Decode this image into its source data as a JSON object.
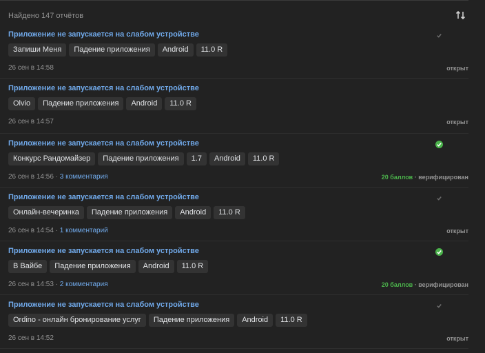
{
  "header": {
    "found_text": "Найдено 147 отчётов",
    "sort_icon": "sort-arrows-icon"
  },
  "colors": {
    "background": "#222222",
    "link": "#71aaeb",
    "tag_bg": "#333333",
    "muted": "#939393",
    "success": "#4bb34b"
  },
  "reports": [
    {
      "title": "Приложение не запускается на слабом устройстве",
      "check": "grey",
      "tags": [
        "Запиши Меня",
        "Падение приложения",
        "Android",
        "11.0 R"
      ],
      "date": "26 сен в 14:58",
      "comments": "",
      "points": "",
      "status": "открыт"
    },
    {
      "title": "Приложение не запускается на слабом устройстве",
      "check": "none",
      "tags": [
        "Olvio",
        "Падение приложения",
        "Android",
        "11.0 R"
      ],
      "date": "26 сен в 14:57",
      "comments": "",
      "points": "",
      "status": "открыт"
    },
    {
      "title": "Приложение не запускается на слабом устройстве",
      "check": "green",
      "tags": [
        "Конкурс Рандомайзер",
        "Падение приложения",
        "1.7",
        "Android",
        "11.0 R"
      ],
      "date": "26 сен в 14:56",
      "comments": "3 комментария",
      "points": "20 баллов",
      "status": "верифицирован"
    },
    {
      "title": "Приложение не запускается на слабом устройстве",
      "check": "grey",
      "tags": [
        "Онлайн-вечеринка",
        "Падение приложения",
        "Android",
        "11.0 R"
      ],
      "date": "26 сен в 14:54",
      "comments": "1 комментарий",
      "points": "",
      "status": "открыт"
    },
    {
      "title": "Приложение не запускается на слабом устройстве",
      "check": "green",
      "tags": [
        "В Вайбе",
        "Падение приложения",
        "Android",
        "11.0 R"
      ],
      "date": "26 сен в 14:53",
      "comments": "2 комментария",
      "points": "20 баллов",
      "status": "верифицирован"
    },
    {
      "title": "Приложение не запускается на слабом устройстве",
      "check": "grey",
      "tags": [
        "Ordino - онлайн бронирование услуг",
        "Падение приложения",
        "Android",
        "11.0 R"
      ],
      "date": "26 сен в 14:52",
      "comments": "",
      "points": "",
      "status": "открыт"
    }
  ]
}
